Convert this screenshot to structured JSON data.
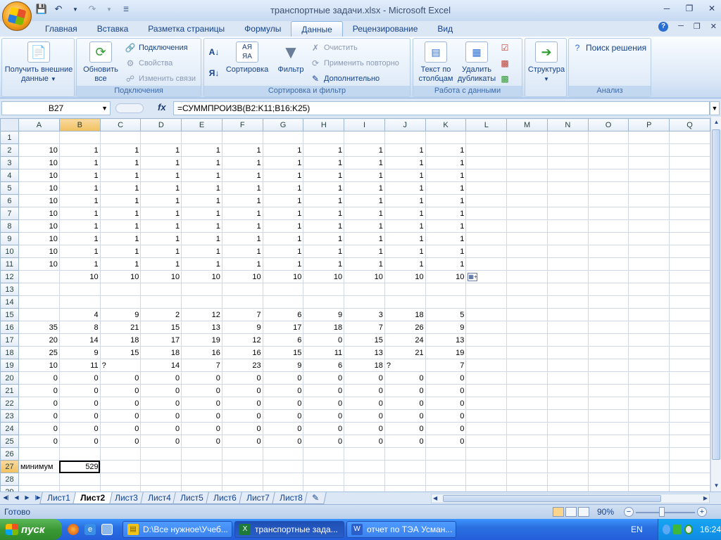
{
  "window": {
    "title": "транспортные задачи.xlsx - Microsoft Excel"
  },
  "tabs": [
    "Главная",
    "Вставка",
    "Разметка страницы",
    "Формулы",
    "Данные",
    "Рецензирование",
    "Вид"
  ],
  "active_tab": "Данные",
  "ribbon": {
    "get_external_data": "Получить внешние данные",
    "refresh_all": "Обновить все",
    "connections": "Подключения",
    "properties": "Свойства",
    "edit_links": "Изменить связи",
    "group_connections": "Подключения",
    "sort": "Сортировка",
    "filter": "Фильтр",
    "clear": "Очистить",
    "reapply": "Применить повторно",
    "advanced": "Дополнительно",
    "group_sort_filter": "Сортировка и фильтр",
    "text_to_columns": "Текст по столбцам",
    "remove_duplicates": "Удалить дубликаты",
    "group_data_tools": "Работа с данными",
    "outline": "Структура",
    "solver": "Поиск решения",
    "group_analysis": "Анализ"
  },
  "formula_bar": {
    "name_box": "B27",
    "formula": "=СУММПРОИЗВ(B2:K11;B16:K25)"
  },
  "columns": [
    "A",
    "B",
    "C",
    "D",
    "E",
    "F",
    "G",
    "H",
    "I",
    "J",
    "K",
    "L",
    "M",
    "N",
    "O",
    "P",
    "Q"
  ],
  "selected_column": "B",
  "selected_row": "27",
  "rows": [
    {
      "n": "1",
      "cells": []
    },
    {
      "n": "2",
      "cells": [
        "10",
        "1",
        "1",
        "1",
        "1",
        "1",
        "1",
        "1",
        "1",
        "1",
        "1"
      ]
    },
    {
      "n": "3",
      "cells": [
        "10",
        "1",
        "1",
        "1",
        "1",
        "1",
        "1",
        "1",
        "1",
        "1",
        "1"
      ]
    },
    {
      "n": "4",
      "cells": [
        "10",
        "1",
        "1",
        "1",
        "1",
        "1",
        "1",
        "1",
        "1",
        "1",
        "1"
      ]
    },
    {
      "n": "5",
      "cells": [
        "10",
        "1",
        "1",
        "1",
        "1",
        "1",
        "1",
        "1",
        "1",
        "1",
        "1"
      ]
    },
    {
      "n": "6",
      "cells": [
        "10",
        "1",
        "1",
        "1",
        "1",
        "1",
        "1",
        "1",
        "1",
        "1",
        "1"
      ]
    },
    {
      "n": "7",
      "cells": [
        "10",
        "1",
        "1",
        "1",
        "1",
        "1",
        "1",
        "1",
        "1",
        "1",
        "1"
      ]
    },
    {
      "n": "8",
      "cells": [
        "10",
        "1",
        "1",
        "1",
        "1",
        "1",
        "1",
        "1",
        "1",
        "1",
        "1"
      ]
    },
    {
      "n": "9",
      "cells": [
        "10",
        "1",
        "1",
        "1",
        "1",
        "1",
        "1",
        "1",
        "1",
        "1",
        "1"
      ]
    },
    {
      "n": "10",
      "cells": [
        "10",
        "1",
        "1",
        "1",
        "1",
        "1",
        "1",
        "1",
        "1",
        "1",
        "1"
      ]
    },
    {
      "n": "11",
      "cells": [
        "10",
        "1",
        "1",
        "1",
        "1",
        "1",
        "1",
        "1",
        "1",
        "1",
        "1"
      ]
    },
    {
      "n": "12",
      "cells": [
        "",
        "10",
        "10",
        "10",
        "10",
        "10",
        "10",
        "10",
        "10",
        "10",
        "10"
      ]
    },
    {
      "n": "13",
      "cells": []
    },
    {
      "n": "14",
      "cells": []
    },
    {
      "n": "15",
      "cells": [
        "",
        "4",
        "9",
        "2",
        "12",
        "7",
        "6",
        "9",
        "3",
        "18",
        "5"
      ]
    },
    {
      "n": "16",
      "cells": [
        "35",
        "8",
        "21",
        "15",
        "13",
        "9",
        "17",
        "18",
        "7",
        "26",
        "9"
      ]
    },
    {
      "n": "17",
      "cells": [
        "20",
        "14",
        "18",
        "17",
        "19",
        "12",
        "6",
        "0",
        "15",
        "24",
        "13"
      ]
    },
    {
      "n": "18",
      "cells": [
        "25",
        "9",
        "15",
        "18",
        "16",
        "16",
        "15",
        "11",
        "13",
        "21",
        "19"
      ]
    },
    {
      "n": "19",
      "cells": [
        "10",
        "11",
        "?",
        "14",
        "7",
        "23",
        "9",
        "6",
        "18",
        "?",
        "7"
      ]
    },
    {
      "n": "20",
      "cells": [
        "0",
        "0",
        "0",
        "0",
        "0",
        "0",
        "0",
        "0",
        "0",
        "0",
        "0"
      ]
    },
    {
      "n": "21",
      "cells": [
        "0",
        "0",
        "0",
        "0",
        "0",
        "0",
        "0",
        "0",
        "0",
        "0",
        "0"
      ]
    },
    {
      "n": "22",
      "cells": [
        "0",
        "0",
        "0",
        "0",
        "0",
        "0",
        "0",
        "0",
        "0",
        "0",
        "0"
      ]
    },
    {
      "n": "23",
      "cells": [
        "0",
        "0",
        "0",
        "0",
        "0",
        "0",
        "0",
        "0",
        "0",
        "0",
        "0"
      ]
    },
    {
      "n": "24",
      "cells": [
        "0",
        "0",
        "0",
        "0",
        "0",
        "0",
        "0",
        "0",
        "0",
        "0",
        "0"
      ]
    },
    {
      "n": "25",
      "cells": [
        "0",
        "0",
        "0",
        "0",
        "0",
        "0",
        "0",
        "0",
        "0",
        "0",
        "0"
      ]
    },
    {
      "n": "26",
      "cells": []
    },
    {
      "n": "27",
      "cells": [
        "минимум",
        "529"
      ]
    },
    {
      "n": "28",
      "cells": []
    },
    {
      "n": "29",
      "cells": []
    }
  ],
  "sheets": [
    "Лист1",
    "Лист2",
    "Лист3",
    "Лист4",
    "Лист5",
    "Лист6",
    "Лист7",
    "Лист8"
  ],
  "active_sheet": "Лист2",
  "status": {
    "ready": "Готово",
    "zoom": "90%",
    "zoom_level": 90
  },
  "taskbar": {
    "start": "пуск",
    "tasks": [
      "D:\\Все нужное\\Учеб...",
      "транспортные зада...",
      "отчет по ТЭА Усман..."
    ],
    "active_task": 1,
    "lang": "EN",
    "clock": "16:24"
  }
}
